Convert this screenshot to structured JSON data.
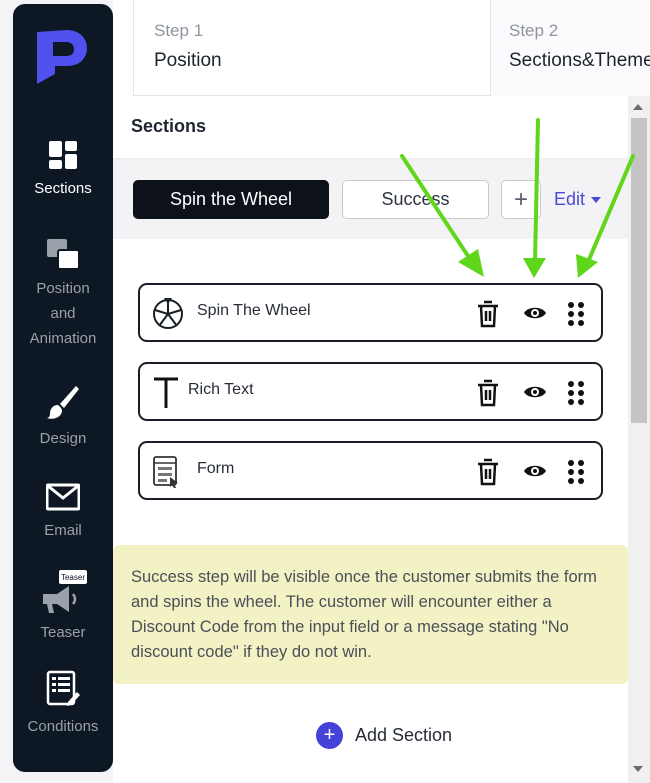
{
  "sidebar": {
    "items": [
      {
        "label": "Sections",
        "icon": "sections-icon",
        "active": true
      },
      {
        "label": "Position and Animation",
        "icon": "position-icon",
        "active": false
      },
      {
        "label": "Design",
        "icon": "brush-icon",
        "active": false
      },
      {
        "label": "Email",
        "icon": "envelope-icon",
        "active": false
      },
      {
        "label": "Teaser",
        "icon": "megaphone-icon",
        "badge": "Teaser",
        "active": false
      },
      {
        "label": "Conditions",
        "icon": "document-icon",
        "active": false
      }
    ]
  },
  "steps": [
    {
      "number": "Step 1",
      "title": "Position"
    },
    {
      "number": "Step 2",
      "title": "Sections&Theme"
    }
  ],
  "panel": {
    "title": "Sections",
    "tabs": {
      "active": "Spin the Wheel",
      "second": "Success",
      "add": "+",
      "edit": "Edit"
    },
    "sections": [
      {
        "label": "Spin The Wheel",
        "icon": "wheel-icon"
      },
      {
        "label": "Rich Text",
        "icon": "text-t-icon"
      },
      {
        "label": "Form",
        "icon": "form-icon"
      }
    ],
    "notice": "Success step will be visible once the customer submits the form and spins the wheel. The customer will encounter either a Discount Code from the input field or a message stating \"No discount code\" if they do not win.",
    "add_section": "Add Section"
  },
  "colors": {
    "sidebar": "#0e1724",
    "accent": "#4542d9",
    "arrow": "#5fd619",
    "notice_bg": "#f3f2c4"
  }
}
